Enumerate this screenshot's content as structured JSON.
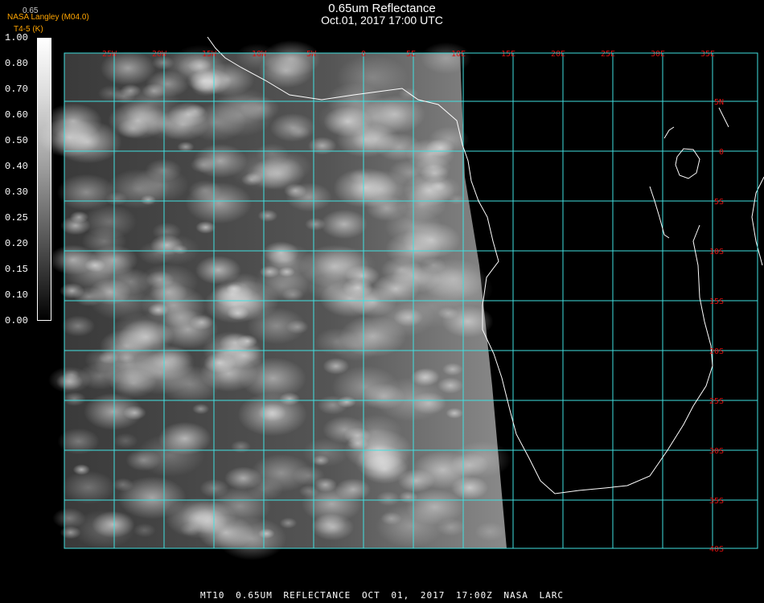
{
  "header": {
    "title": "0.65um Reflectance",
    "subtitle": "Oct.01, 2017 17:00 UTC",
    "credit": "NASA Langley (M04.0)",
    "credit2": "T4-5 (K)",
    "colorbar_top_label": "0.65"
  },
  "colorbar": {
    "ticks": [
      "1.00",
      "0.80",
      "0.70",
      "0.60",
      "0.50",
      "0.40",
      "0.30",
      "0.25",
      "0.20",
      "0.15",
      "0.10",
      "0.00"
    ]
  },
  "map": {
    "lon_labels": [
      "25W",
      "20W",
      "15W",
      "10W",
      "5W",
      "0",
      "5E",
      "10E",
      "15E",
      "20E",
      "25E",
      "30E",
      "35E"
    ],
    "lat_labels": [
      "5N",
      "0",
      "5S",
      "10S",
      "15S",
      "20S",
      "25S",
      "30S",
      "35S",
      "40S"
    ],
    "colors": {
      "grid": "#40e0e0",
      "labels": "#e01010",
      "coast": "#ffffff"
    }
  },
  "footer": {
    "product": "MT10",
    "band": "0.65UM REFLECTANCE",
    "datetime": "OCT 01, 2017 17:00Z",
    "source": "NASA LARC"
  }
}
